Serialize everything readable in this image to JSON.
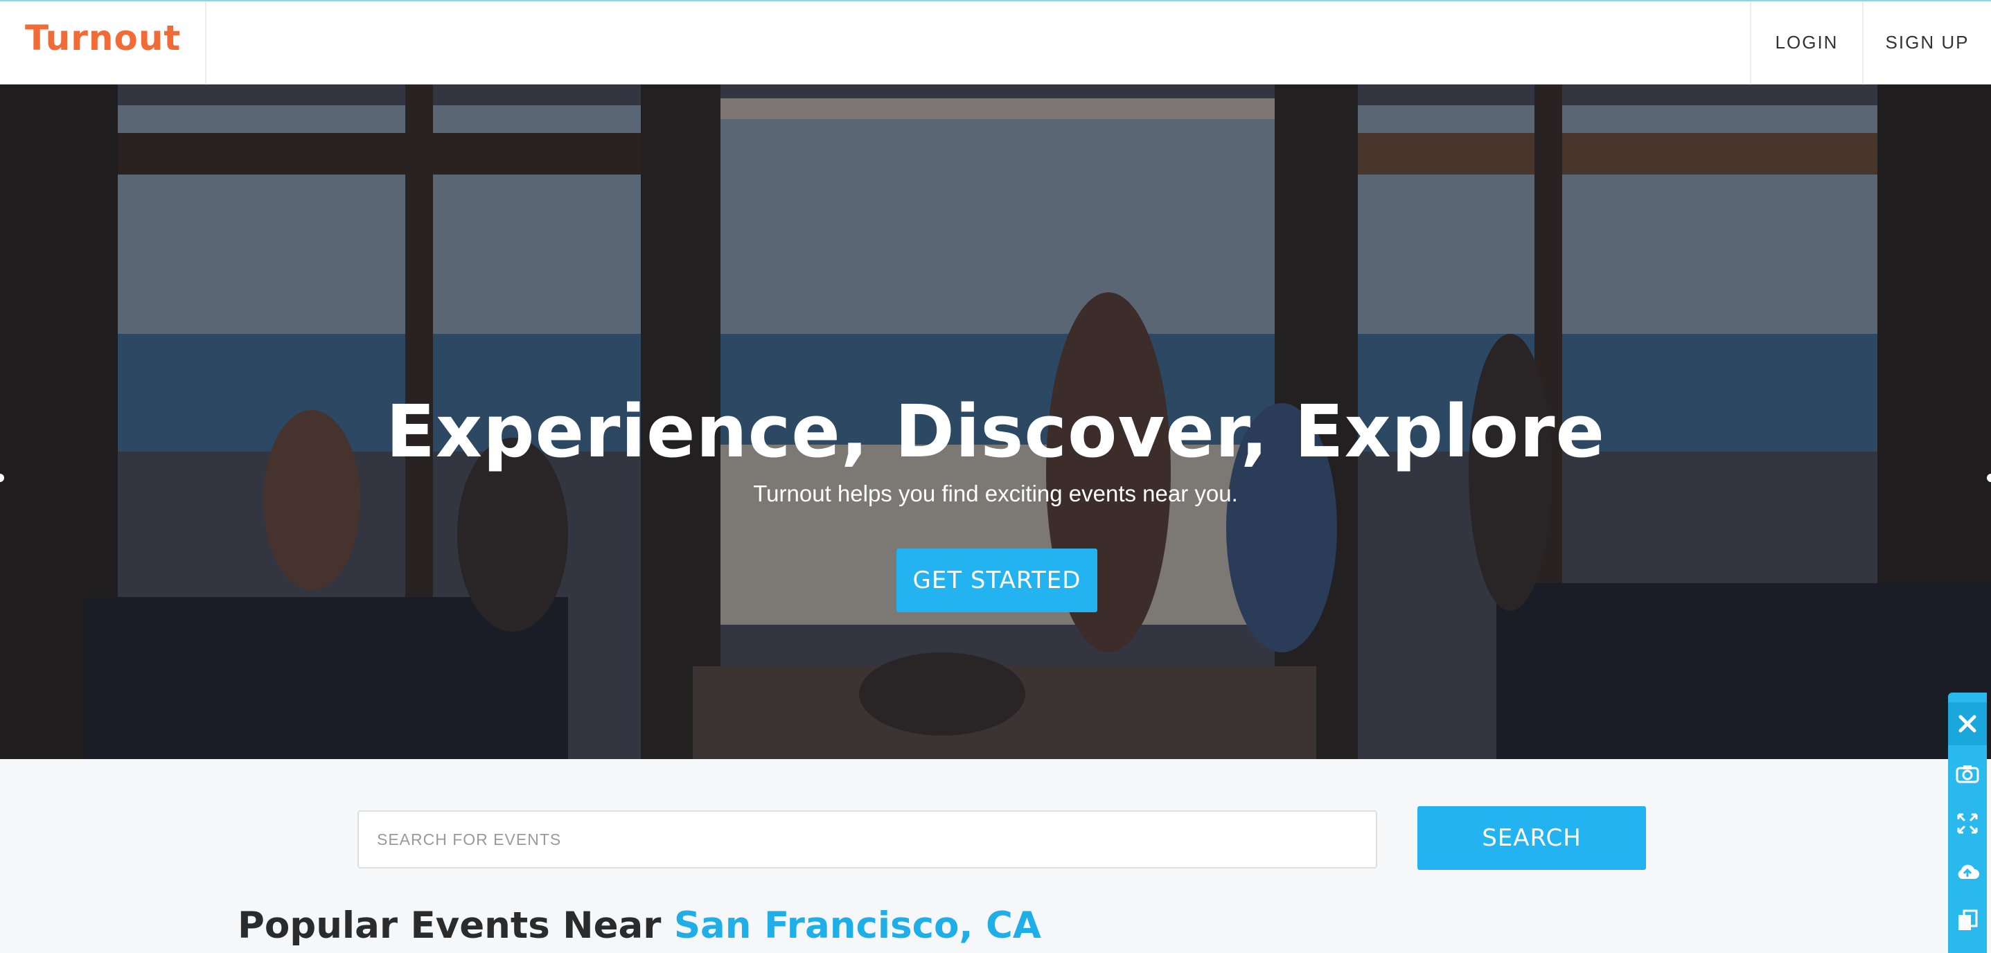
{
  "nav": {
    "logo": "Turnout",
    "login": "LOGIN",
    "signup": "SIGN UP"
  },
  "hero": {
    "title": "Experience, Discover, Explore",
    "subtitle": "Turnout helps you find exciting events near you.",
    "cta": "GET STARTED"
  },
  "search": {
    "placeholder": "SEARCH FOR EVENTS",
    "value": "",
    "button": "SEARCH"
  },
  "popular": {
    "prefix": "Popular Events Near",
    "location": "San Francisco, CA"
  },
  "toolbar": {
    "icons": [
      "close-icon",
      "camera-icon",
      "expand-icon",
      "cloud-upload-icon",
      "copy-icon"
    ]
  },
  "colors": {
    "brand": "#f26b37",
    "accent": "#22b3f0",
    "location": "#1eaee8"
  }
}
